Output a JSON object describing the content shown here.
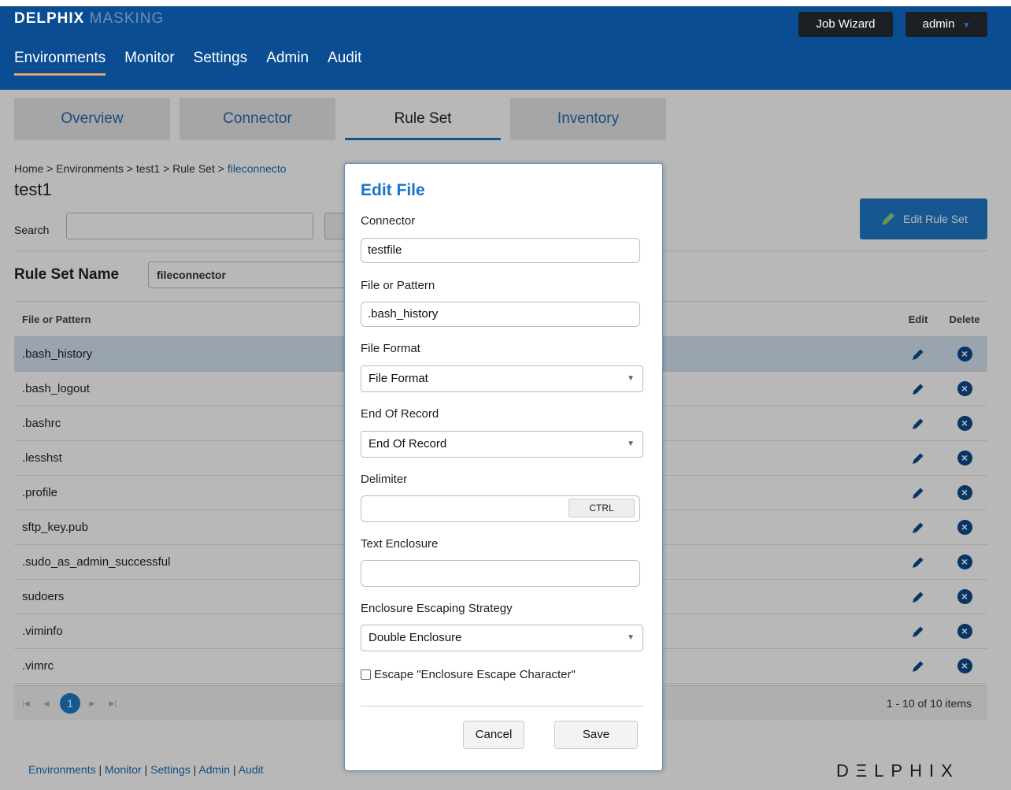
{
  "header": {
    "logo_bold": "DELPHIX",
    "logo_light": "MASKING",
    "job_wizard_label": "Job Wizard",
    "user_label": "admin",
    "nav": [
      "Environments",
      "Monitor",
      "Settings",
      "Admin",
      "Audit"
    ],
    "active_nav": "Environments"
  },
  "tabs": [
    "Overview",
    "Connector",
    "Rule Set",
    "Inventory"
  ],
  "active_tab": "Rule Set",
  "breadcrumb": {
    "path": "Home > Environments > test1 > Rule Set > ",
    "current": "fileconnecto"
  },
  "page_title": "test1",
  "search": {
    "label": "Search",
    "value": ""
  },
  "edit_rule_set_label": "Edit Rule Set",
  "rule_set_name": {
    "label": "Rule Set Name",
    "value": "fileconnector"
  },
  "grid": {
    "col_file": "File or Pattern",
    "col_edit": "Edit",
    "col_delete": "Delete",
    "rows": [
      ".bash_history",
      ".bash_logout",
      ".bashrc",
      ".lesshst",
      ".profile",
      "sftp_key.pub",
      ".sudo_as_admin_successful",
      "sudoers",
      ".viminfo",
      ".vimrc"
    ],
    "selected_index": 0
  },
  "pager": {
    "current_page": "1",
    "info": "1 - 10 of 10 items"
  },
  "footer": {
    "links": [
      "Environments",
      "Monitor",
      "Settings",
      "Admin",
      "Audit"
    ],
    "logo": "DΞLPHIX"
  },
  "modal": {
    "title": "Edit File",
    "connector_label": "Connector",
    "connector_value": "testfile",
    "file_pattern_label": "File or Pattern",
    "file_pattern_value": ".bash_history",
    "file_format_label": "File Format",
    "file_format_value": "File Format",
    "end_of_record_label": "End Of Record",
    "end_of_record_value": "End Of Record",
    "delimiter_label": "Delimiter",
    "delimiter_value": "",
    "ctrl_label": "CTRL",
    "text_enclosure_label": "Text Enclosure",
    "text_enclosure_value": "",
    "escaping_label": "Enclosure Escaping Strategy",
    "escaping_value": "Double Enclosure",
    "escape_checkbox_label": "Escape \"Enclosure Escape Character\"",
    "escape_checked": false,
    "cancel_label": "Cancel",
    "save_label": "Save"
  },
  "colors": {
    "header_bg": "#0b4d93",
    "accent": "#1f79c9",
    "nav_underline": "#e0a862",
    "selected_row": "#d4e3f2"
  }
}
